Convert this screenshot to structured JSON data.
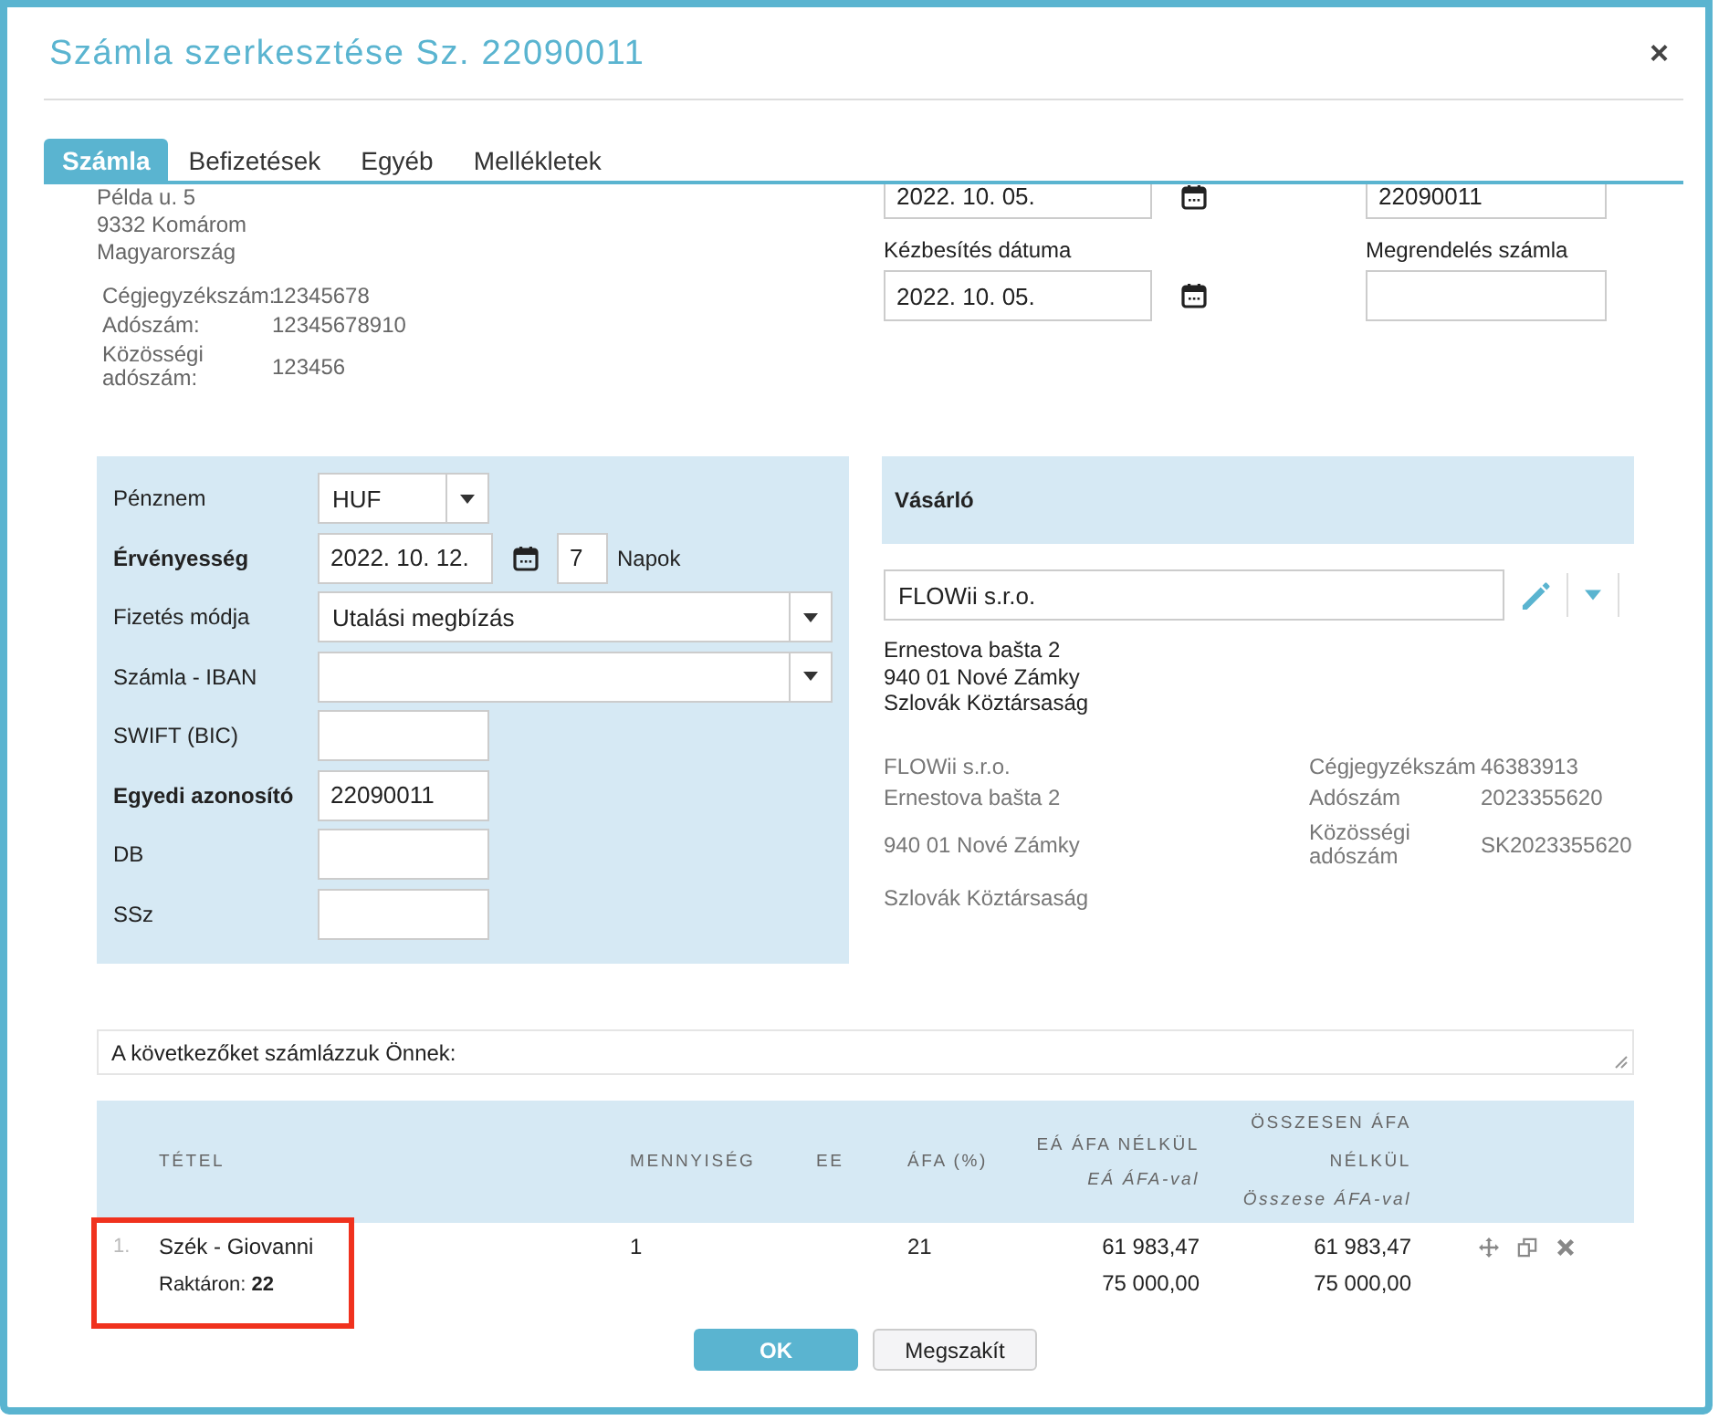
{
  "dialog": {
    "title": "Számla szerkesztése Sz. 22090011",
    "close": "×"
  },
  "tabs": [
    {
      "label": "Számla",
      "selected": true
    },
    {
      "label": "Befizetések",
      "selected": false
    },
    {
      "label": "Egyéb",
      "selected": false
    },
    {
      "label": "Mellékletek",
      "selected": false
    }
  ],
  "issuer": {
    "address_lines": [
      "Példa u. 5",
      "9332 Komárom",
      "Magyarország"
    ],
    "details": [
      {
        "label": "Cégjegyzékszám:",
        "value": "12345678"
      },
      {
        "label": "Adószám:",
        "value": "12345678910"
      },
      {
        "label": "Közösségi adószám:",
        "value": "123456"
      }
    ]
  },
  "date_fields": [
    {
      "value": "2022. 10. 05."
    },
    {
      "label": "Kézbesítés dátuma",
      "value": "2022. 10. 05."
    }
  ],
  "order_fields": [
    {
      "value": "22090011"
    },
    {
      "label": "Megrendelés számla"
    }
  ],
  "payment": [
    {
      "kind": "currency",
      "label": "Pénznem",
      "required": false,
      "value": "HUF"
    },
    {
      "kind": "validity",
      "label": "Érvényesség",
      "required": true,
      "value": "2022. 10. 12.",
      "days": "7",
      "days_label": "Napok"
    },
    {
      "kind": "select",
      "label": "Fizetés módja",
      "required": false,
      "value": "Utalási megbízás"
    },
    {
      "kind": "select",
      "label": "Számla - IBAN",
      "required": false
    },
    {
      "kind": "input",
      "label": "SWIFT (BIC)",
      "required": false
    },
    {
      "kind": "input",
      "label": "Egyedi azonosító",
      "required": true,
      "value": "22090011"
    },
    {
      "kind": "input",
      "label": "DB",
      "required": false
    },
    {
      "kind": "input",
      "label": "SSz",
      "required": false
    }
  ],
  "customer": {
    "title": "Vásárló",
    "name": "FLOWii s.r.o.",
    "address_lines": [
      "Ernestova bašta 2",
      "940 01 Nové Zámky",
      "Szlovák Köztársaság"
    ],
    "details_left": [
      "FLOWii s.r.o.",
      "Ernestova bašta 2",
      "940 01 Nové Zámky",
      "Szlovák Köztársaság"
    ],
    "details_right": [
      {
        "label": "Cégjegyzékszám",
        "value": "46383913"
      },
      {
        "label": "Adószám",
        "value": "2023355620"
      },
      {
        "label": "Közösségi adószám",
        "value": "SK2023355620"
      }
    ]
  },
  "note": {
    "value": "A következőket számlázzuk Önnek:"
  },
  "table": {
    "columns": [
      {
        "label": "TÉTEL"
      },
      {
        "label": "MENNYISÉG"
      },
      {
        "label": "EE"
      },
      {
        "label": "ÁFA (%)"
      },
      {
        "label": "EÁ ÁFA NÉLKÜL",
        "sub": "EÁ ÁFA-val"
      },
      {
        "label": "ÖSSZESEN ÁFA NÉLKÜL",
        "sub": "Összese ÁFA-val"
      }
    ],
    "rows": [
      {
        "number": "1.",
        "name": "Szék - Giovanni",
        "stock": "Raktáron: **22**",
        "quantity": "1",
        "vat": "21",
        "unit_net": "61 983,47",
        "unit_gross": "75 000,00",
        "total_net": "61 983,47",
        "total_gross": "75 000,00",
        "highlighted": true
      }
    ]
  },
  "buttons": [
    {
      "label": "OK",
      "kind": "primary"
    },
    {
      "label": "Megszakít",
      "kind": "secondary"
    }
  ]
}
